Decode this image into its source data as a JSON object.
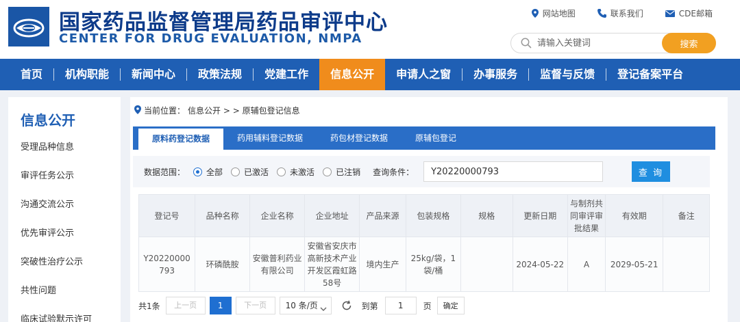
{
  "header": {
    "title_cn": "国家药品监督管理局药品审评中心",
    "title_en": "CENTER FOR DRUG EVALUATION, NMPA",
    "links": [
      {
        "label": "网站地图",
        "icon": "location-pin-icon"
      },
      {
        "label": "联系我们",
        "icon": "phone-icon"
      },
      {
        "label": "CDE邮箱",
        "icon": "mail-icon"
      }
    ],
    "search_placeholder": "请输入关键词",
    "search_button": "搜索"
  },
  "nav": {
    "items": [
      "首页",
      "机构职能",
      "新闻中心",
      "政策法规",
      "党建工作",
      "信息公开",
      "申请人之窗",
      "办事服务",
      "监督与反馈",
      "登记备案平台"
    ],
    "active": "信息公开"
  },
  "sidebar": {
    "title": "信息公开",
    "items": [
      "受理品种信息",
      "审评任务公示",
      "沟通交流公示",
      "优先审评公示",
      "突破性治疗公示",
      "共性问题",
      "临床试验默示许可"
    ]
  },
  "breadcrumb": {
    "prefix": "当前位置：",
    "path": "信息公开 > > 原辅包登记信息"
  },
  "tabs": {
    "items": [
      "原料药登记数据",
      "药用辅料登记数据",
      "药包材登记数据",
      "原辅包登记"
    ],
    "active": "原料药登记数据"
  },
  "filter": {
    "range_label": "数据范围：",
    "options": [
      "全部",
      "已激活",
      "未激活",
      "已注销"
    ],
    "selected": "全部",
    "condition_label": "查询条件：",
    "condition_value": "Y20220000793",
    "query_button": "查 询"
  },
  "table": {
    "columns": [
      "登记号",
      "品种名称",
      "企业名称",
      "企业地址",
      "产品来源",
      "包装规格",
      "规格",
      "更新日期",
      "与制剂共同审评审批结果",
      "有效期",
      "备注"
    ],
    "rows": [
      [
        "Y20220000793",
        "环磷酰胺",
        "安徽普利药业有限公司",
        "安徽省安庆市高新技术产业开发区霞虹路58号",
        "境内生产",
        "25kg/袋，1袋/桶",
        "",
        "2024-05-22",
        "A",
        "2029-05-21",
        ""
      ]
    ]
  },
  "pager": {
    "total": "共1条",
    "prev": "上一页",
    "current": "1",
    "next": "下一页",
    "page_size": "10 条/页",
    "goto_label": "到第",
    "goto_value": "1",
    "page_unit": "页",
    "confirm": "确定"
  },
  "colors": {
    "nav_blue": "#1f5fb4",
    "active_orange": "#f08c1c",
    "search_orange": "#f2a021",
    "query_blue": "#1f8ee0",
    "title_navy": "#0d3b8a"
  }
}
